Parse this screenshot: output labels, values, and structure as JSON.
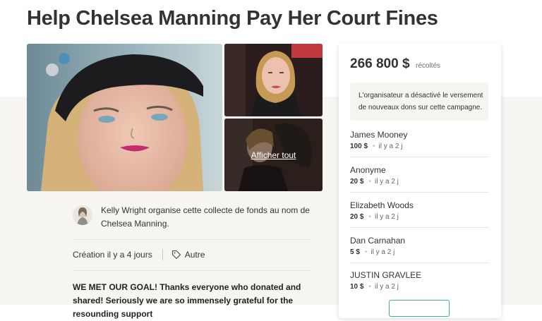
{
  "page": {
    "title": "Help Chelsea Manning Pay Her Court Fines"
  },
  "gallery": {
    "view_all_label": "Afficher tout"
  },
  "organizer": {
    "text": "Kelly Wright organise cette collecte de fonds au nom de Chelsea Manning."
  },
  "meta": {
    "created": "Création il y a 4 jours",
    "category": "Autre"
  },
  "story": {
    "text": "WE MET OUR GOAL! Thanks everyone who donated and shared! Seriously we are so immensely grateful for the resounding support"
  },
  "sidebar": {
    "amount": "266 800 $",
    "amount_suffix": "récoltés",
    "notice": "L'organisateur a désactivé le versement de nouveaux dons sur cette campagne.",
    "donations": [
      {
        "name": "James Mooney",
        "amount": "100 $",
        "time": "il y a 2 j"
      },
      {
        "name": "Anonyme",
        "amount": "20 $",
        "time": "il y a 2 j"
      },
      {
        "name": "Elizabeth Woods",
        "amount": "20 $",
        "time": "il y a 2 j"
      },
      {
        "name": "Dan Carnahan",
        "amount": "5 $",
        "time": "il y a 2 j"
      },
      {
        "name": "JUSTIN GRAVLEE",
        "amount": "10 $",
        "time": "il y a 2 j"
      }
    ]
  },
  "colors": {
    "accent": "#3bb39a",
    "band_background": "#f6f5f2"
  },
  "icons": {
    "tag": "tag-icon",
    "separator_dot": "dot-icon"
  }
}
